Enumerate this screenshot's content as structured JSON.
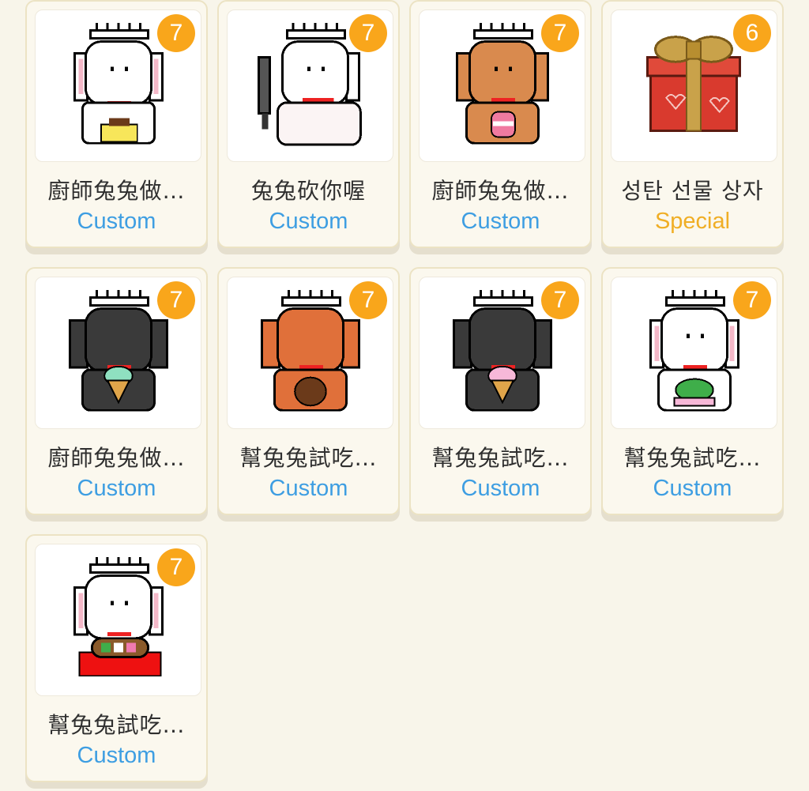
{
  "stickers": [
    {
      "title": "廚師兔兔做…",
      "type": "Custom",
      "badge": "7",
      "icon": "white-chef-bunny-pudding"
    },
    {
      "title": "兔兔砍你喔",
      "type": "Custom",
      "badge": "7",
      "icon": "white-chef-bunny-knife"
    },
    {
      "title": "廚師兔兔做…",
      "type": "Custom",
      "badge": "7",
      "icon": "brown-chef-bunny-cake"
    },
    {
      "title": "성탄 선물 상자",
      "type": "Special",
      "badge": "6",
      "icon": "christmas-gift-box"
    },
    {
      "title": "廚師兔兔做…",
      "type": "Custom",
      "badge": "7",
      "icon": "black-chef-bunny-mint-icecream"
    },
    {
      "title": "幫兔兔試吃…",
      "type": "Custom",
      "badge": "7",
      "icon": "orange-chef-bunny-chocolate"
    },
    {
      "title": "幫兔兔試吃…",
      "type": "Custom",
      "badge": "7",
      "icon": "black-chef-bunny-strawberry-icecream"
    },
    {
      "title": "幫兔兔試吃…",
      "type": "Custom",
      "badge": "7",
      "icon": "white-chef-bunny-mochi"
    },
    {
      "title": "幫兔兔試吃…",
      "type": "Custom",
      "badge": "7",
      "icon": "white-chef-bunny-dango"
    }
  ],
  "colors": {
    "badge": "#f9a61b",
    "custom": "#3e9ee2",
    "special": "#f0ae25",
    "background": "#f8f5ea"
  }
}
